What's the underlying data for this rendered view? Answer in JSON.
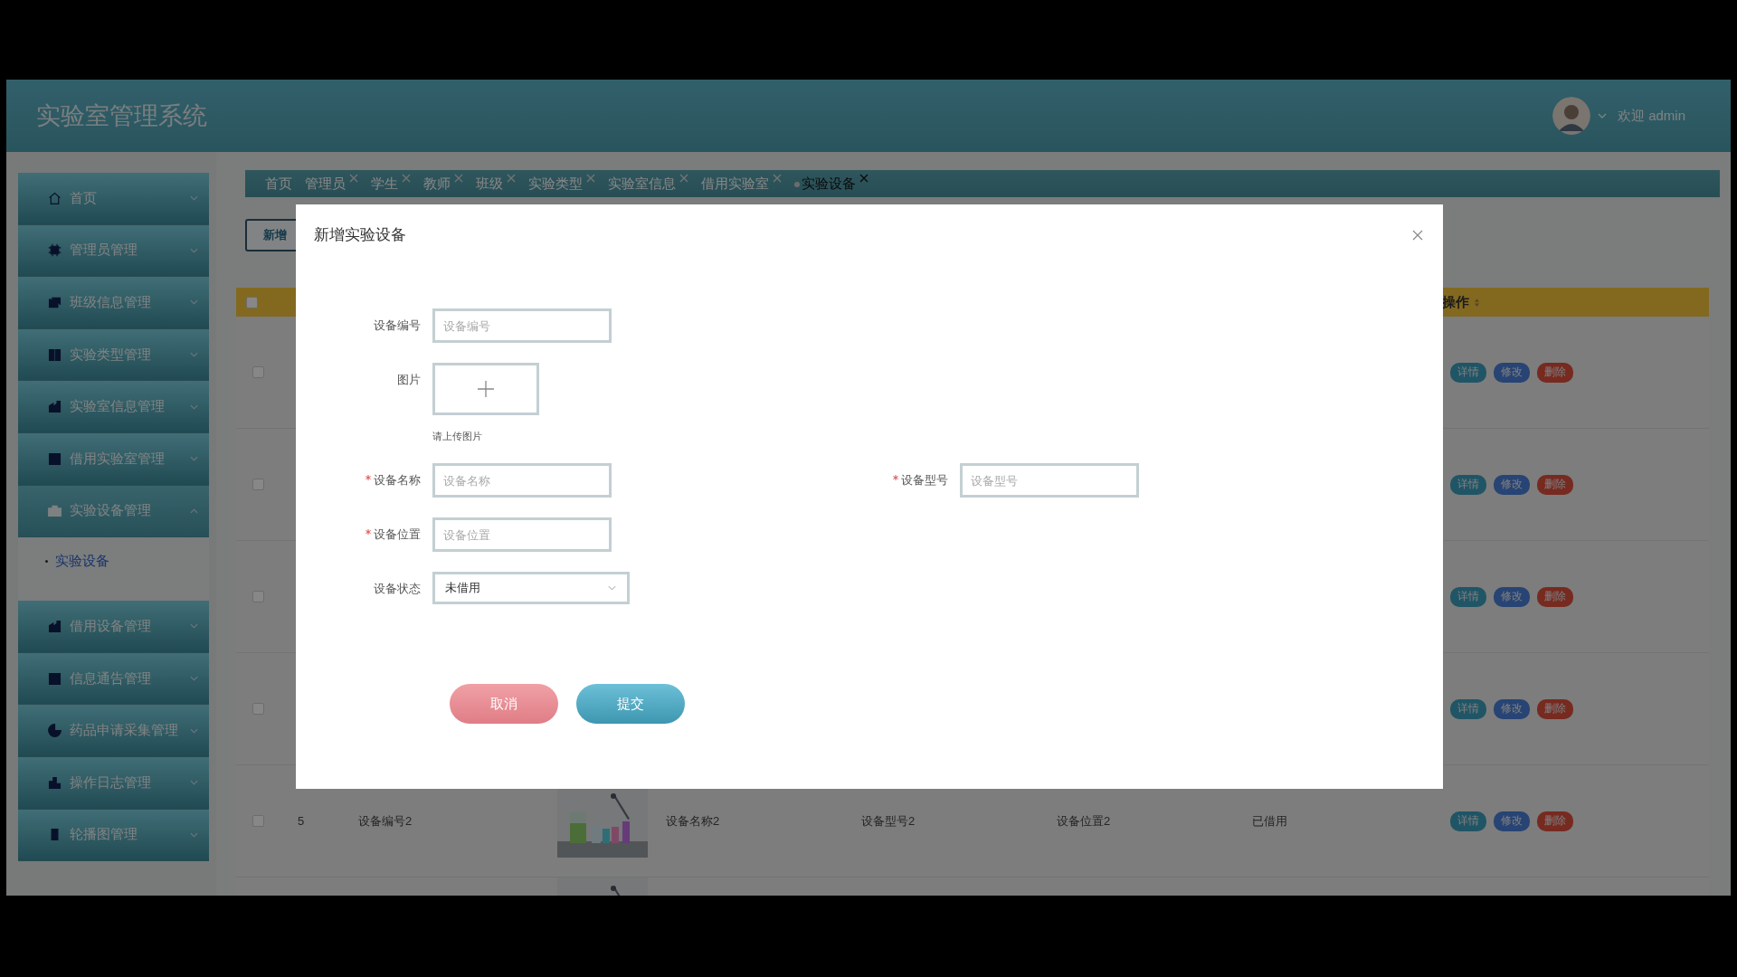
{
  "header": {
    "title": "实验室管理系统",
    "welcome": "欢迎 admin"
  },
  "sidebar": {
    "items": [
      {
        "label": "首页",
        "expanded": false
      },
      {
        "label": "管理员管理",
        "expanded": false
      },
      {
        "label": "班级信息管理",
        "expanded": false
      },
      {
        "label": "实验类型管理",
        "expanded": false
      },
      {
        "label": "实验室信息管理",
        "expanded": false
      },
      {
        "label": "借用实验室管理",
        "expanded": false
      },
      {
        "label": "实验设备管理",
        "expanded": true,
        "children": [
          {
            "label": "实验设备",
            "selected": true
          }
        ]
      },
      {
        "label": "借用设备管理",
        "expanded": false
      },
      {
        "label": "信息通告管理",
        "expanded": false
      },
      {
        "label": "药品申请采集管理",
        "expanded": false
      },
      {
        "label": "操作日志管理",
        "expanded": false
      },
      {
        "label": "轮播图管理",
        "expanded": false
      }
    ]
  },
  "tabs": [
    {
      "label": "首页",
      "closable": false,
      "selected": false
    },
    {
      "label": "管理员",
      "closable": true,
      "selected": false
    },
    {
      "label": "学生",
      "closable": true,
      "selected": false
    },
    {
      "label": "教师",
      "closable": true,
      "selected": false
    },
    {
      "label": "班级",
      "closable": true,
      "selected": false
    },
    {
      "label": "实验类型",
      "closable": true,
      "selected": false
    },
    {
      "label": "实验室信息",
      "closable": true,
      "selected": false
    },
    {
      "label": "借用实验室",
      "closable": true,
      "selected": false
    },
    {
      "label": "实验设备",
      "closable": true,
      "selected": true
    }
  ],
  "toolbar": {
    "add_button": "新增"
  },
  "table": {
    "header": {
      "checked": false,
      "actions_label": "操作"
    },
    "rows": [
      {
        "checked": false,
        "actions": [
          "详情",
          "修改",
          "删除"
        ]
      },
      {
        "checked": false,
        "actions": [
          "详情",
          "修改",
          "删除"
        ]
      },
      {
        "checked": false,
        "actions": [
          "详情",
          "修改",
          "删除"
        ]
      },
      {
        "checked": false,
        "actions": [
          "详情",
          "修改",
          "删除"
        ]
      },
      {
        "checked": false,
        "index": "5",
        "number": "设备编号2",
        "picture": {
          "kind": "picture"
        },
        "name": "设备名称2",
        "model": "设备型号2",
        "location": "设备位置2",
        "status": "已借用",
        "actions": [
          "详情",
          "修改",
          "删除"
        ]
      },
      {
        "picture": {
          "kind": "picture"
        }
      }
    ]
  },
  "dialog": {
    "title": "新增实验设备",
    "rows": [
      [
        {
          "kind": "text",
          "label": "设备编号",
          "required": false,
          "placeholder": "设备编号"
        }
      ],
      [
        {
          "kind": "upload",
          "label": "图片",
          "required": false,
          "hint": "请上传图片"
        }
      ],
      [
        {
          "kind": "text",
          "label": "设备名称",
          "required": true,
          "placeholder": "设备名称"
        },
        {
          "kind": "text",
          "label": "设备型号",
          "required": true,
          "placeholder": "设备型号"
        }
      ],
      [
        {
          "kind": "text",
          "label": "设备位置",
          "required": true,
          "placeholder": "设备位置"
        }
      ],
      [
        {
          "kind": "select",
          "label": "设备状态",
          "required": false,
          "value": "未借用"
        }
      ]
    ],
    "buttons": [
      {
        "kind": "cancel",
        "label": "取消"
      },
      {
        "kind": "submit",
        "label": "提交"
      }
    ]
  }
}
